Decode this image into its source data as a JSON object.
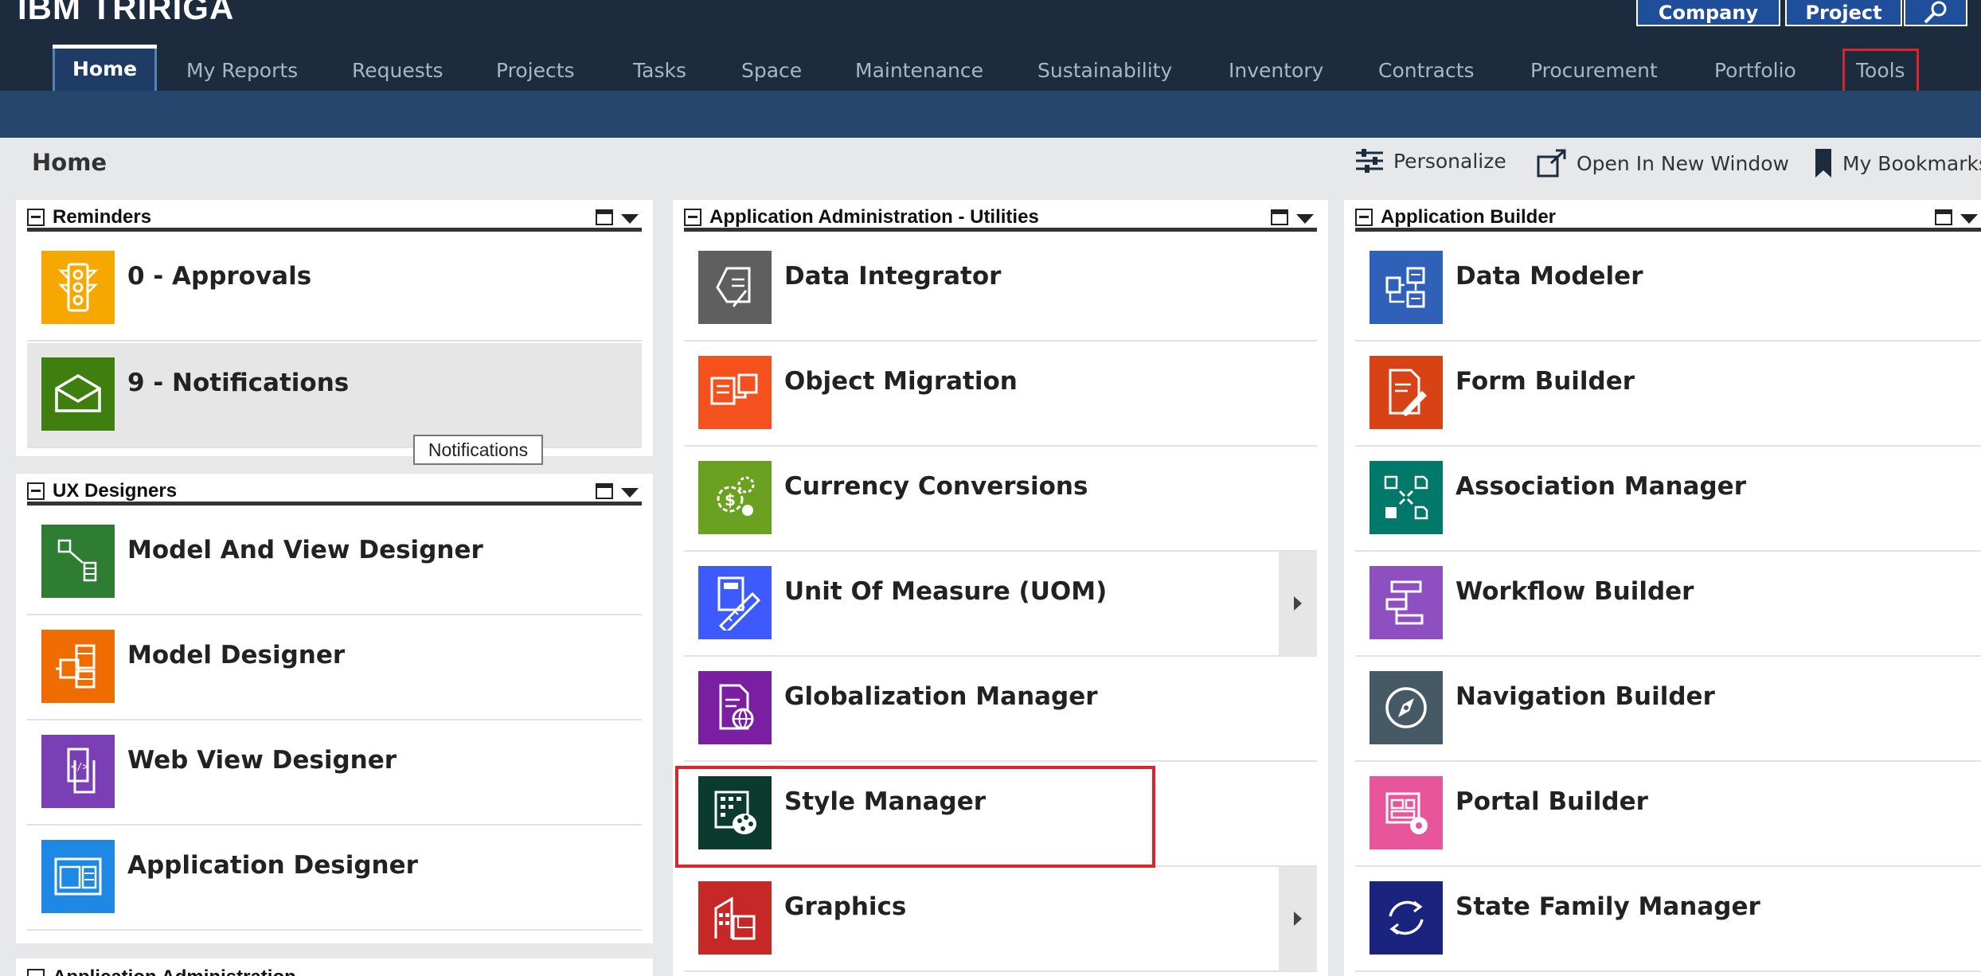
{
  "brand": "IBM TRIRIGA",
  "top_buttons": {
    "company": "Company",
    "project": "Project"
  },
  "nav": [
    "Home",
    "My Reports",
    "Requests",
    "Projects",
    "Tasks",
    "Space",
    "Maintenance",
    "Sustainability",
    "Inventory",
    "Contracts",
    "Procurement",
    "Portfolio",
    "Tools"
  ],
  "page": {
    "title": "Home",
    "personalize": "Personalize",
    "open_new_window": "Open In New Window",
    "bookmarks": "My Bookmarks"
  },
  "reminders": {
    "title": "Reminders",
    "items": [
      "0 - Approvals",
      "9 - Notifications"
    ]
  },
  "tooltip": "Notifications",
  "ux": {
    "title": "UX Designers",
    "items": [
      "Model And View Designer",
      "Model Designer",
      "Web View Designer",
      "Application Designer"
    ]
  },
  "bottom_left_title": "Application Administration",
  "utilities": {
    "title": "Application Administration - Utilities",
    "items": [
      "Data Integrator",
      "Object Migration",
      "Currency Conversions",
      "Unit Of Measure (UOM)",
      "Globalization Manager",
      "Style Manager",
      "Graphics"
    ]
  },
  "builder": {
    "title": "Application Builder",
    "items": [
      "Data Modeler",
      "Form Builder",
      "Association Manager",
      "Workflow Builder",
      "Navigation Builder",
      "Portal Builder",
      "State Family Manager"
    ]
  },
  "colors": {
    "approvals": "#f7a800",
    "notifications": "#3f7f0f",
    "model_view": "#2e7d32",
    "model": "#ef6c00",
    "web_view": "#7b3fb5",
    "app_designer": "#1e88e5",
    "data_integrator": "#5f5f5f",
    "object_migration": "#f4511e",
    "currency": "#6aa120",
    "uom": "#3d5afe",
    "globalization": "#7b1fa2",
    "style_manager": "#0b3b2e",
    "graphics": "#c62828",
    "data_modeler": "#2f61b8",
    "form_builder": "#d84315",
    "association": "#00796b",
    "workflow": "#8e4fc1",
    "navigation": "#455a64",
    "portal": "#e9559a",
    "state_family": "#1a237e"
  }
}
